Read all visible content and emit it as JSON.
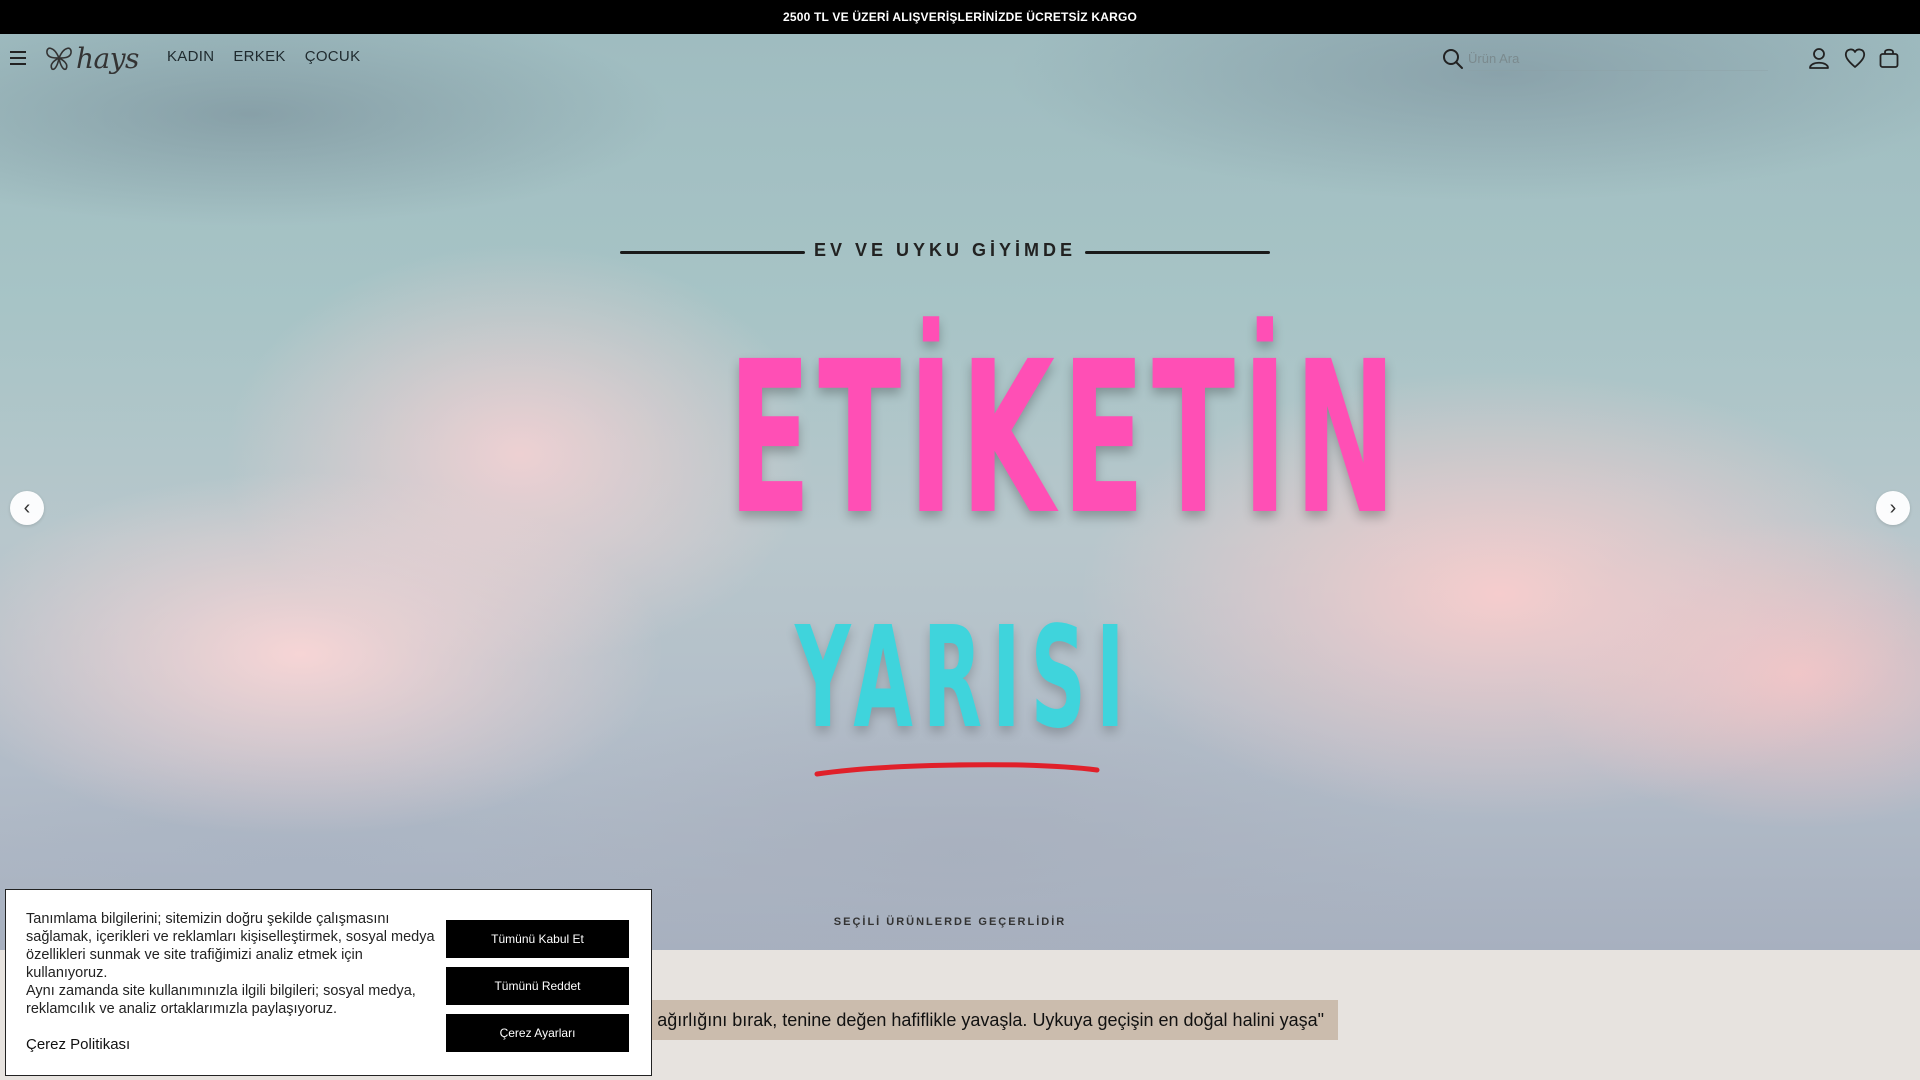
{
  "announcement": {
    "text": "2500 TL VE ÜZERİ ALIŞVERİŞLERİNİZDE ÜCRETSİZ KARGO"
  },
  "header": {
    "logo_text": "hays",
    "nav": [
      {
        "label": "KADIN"
      },
      {
        "label": "ERKEK"
      },
      {
        "label": "ÇOCUK"
      }
    ],
    "search": {
      "placeholder": "Ürün Ara",
      "value": ""
    },
    "icons": [
      "menu-icon",
      "search-icon",
      "user-icon",
      "heart-icon",
      "bag-icon"
    ]
  },
  "hero": {
    "subheading": "EV VE UYKU GİYİMDE",
    "title_line1": "ETİKETİN",
    "title_line2": "YARISI",
    "disclaimer": "SEÇİLİ ÜRÜNLERDE GEÇERLİDİR",
    "prev_arrow": "‹",
    "next_arrow": "›",
    "colors": {
      "title1": "#ff4fb5",
      "title2": "#3fd4dc",
      "underline": "#e0202a"
    }
  },
  "tagline": {
    "text": "n ağırlığını bırak, tenine değen hafiflikle yavaşla. Uykuya geçişin en doğal halini yaşa\""
  },
  "cookie_banner": {
    "text_part1": "Tanımlama bilgilerini; sitemizin doğru şekilde çalışmasını sağlamak, içerikleri ve reklamları kişiselleştirmek, sosyal medya özellikleri sunmak ve site trafiğimizi analiz etmek için kullanıyoruz.",
    "text_part2": "Aynı zamanda site kullanımınızla ilgili bilgileri; sosyal medya, reklamcılık ve analiz ortaklarımızla paylaşıyoruz.",
    "policy_link": "Çerez Politikası",
    "buttons": {
      "accept_all": "Tümünü Kabul Et",
      "reject_all": "Tümünü Reddet",
      "settings": "Çerez Ayarları"
    }
  }
}
